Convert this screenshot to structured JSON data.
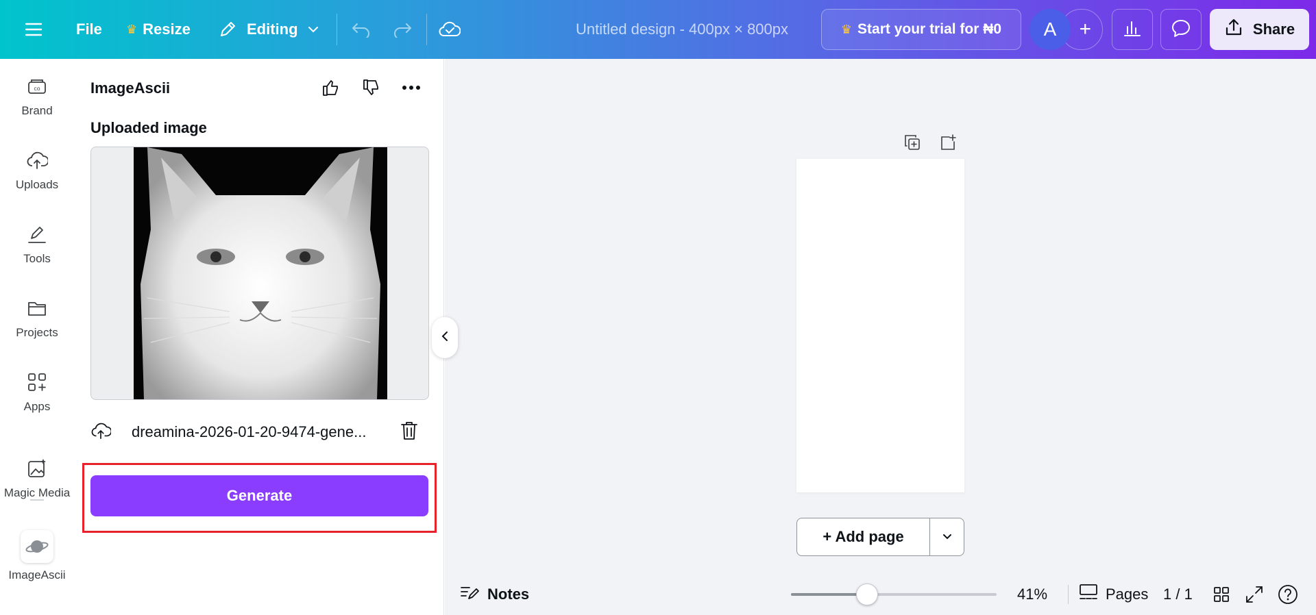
{
  "topbar": {
    "menu_icon": "hamburger-menu-icon",
    "file_label": "File",
    "resize_label": "Resize",
    "editing_label": "Editing",
    "doc_title": "Untitled design - 400px × 800px",
    "trial_label": "Start your trial for ₦0",
    "avatar_letter": "A",
    "share_label": "Share"
  },
  "rail": {
    "items": [
      {
        "label": "Brand",
        "icon": "brand-icon"
      },
      {
        "label": "Uploads",
        "icon": "cloud-upload-icon"
      },
      {
        "label": "Tools",
        "icon": "pen-tool-icon"
      },
      {
        "label": "Projects",
        "icon": "folder-icon"
      },
      {
        "label": "Apps",
        "icon": "apps-grid-icon"
      },
      {
        "label": "Magic Media",
        "icon": "magic-media-icon"
      },
      {
        "label": "ImageAscii",
        "icon": "planet-icon"
      }
    ]
  },
  "panel": {
    "title": "ImageAscii",
    "section_label": "Uploaded image",
    "file_name": "dreamina-2026-01-20-9474-gene...",
    "generate_label": "Generate"
  },
  "bottombar": {
    "notes_label": "Notes",
    "zoom_level": "41%",
    "zoom_fraction": 0.37,
    "pages_label": "Pages",
    "page_count": "1 / 1"
  },
  "canvas": {
    "add_page_label": "+ Add page"
  },
  "colors": {
    "accent_purple": "#8b3dff",
    "highlight_red": "#e8222b",
    "crown_gold": "#ffc83d"
  }
}
